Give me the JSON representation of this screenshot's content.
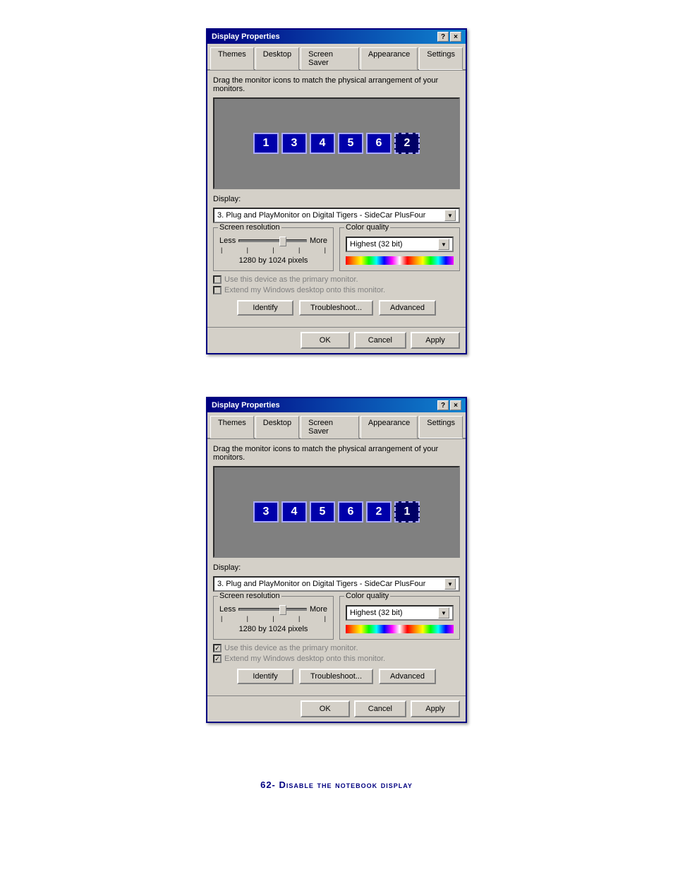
{
  "dialog1": {
    "title": "Display Properties",
    "title_buttons": [
      "?",
      "×"
    ],
    "tabs": [
      "Themes",
      "Desktop",
      "Screen Saver",
      "Appearance",
      "Settings"
    ],
    "active_tab": "Settings",
    "instruction": "Drag the monitor icons to match the physical arrangement of your monitors.",
    "monitors": [
      {
        "label": "1",
        "dashed": false
      },
      {
        "label": "3",
        "dashed": false
      },
      {
        "label": "4",
        "dashed": false
      },
      {
        "label": "5",
        "dashed": false
      },
      {
        "label": "6",
        "dashed": false
      },
      {
        "label": "2",
        "dashed": true
      }
    ],
    "display_label": "Display:",
    "display_value": "3. Plug and PlayMonitor on Digital Tigers - SideCar PlusFour",
    "screen_resolution": {
      "label": "Screen resolution",
      "less": "Less",
      "more": "More",
      "value": "1280 by 1024 pixels"
    },
    "color_quality": {
      "label": "Color quality",
      "value": "Highest (32 bit)"
    },
    "checkboxes": [
      {
        "label": "Use this device as the primary monitor.",
        "checked": false
      },
      {
        "label": "Extend my Windows desktop onto this monitor.",
        "checked": false
      }
    ],
    "buttons": [
      "Identify",
      "Troubleshoot...",
      "Advanced"
    ],
    "bottom_buttons": [
      "OK",
      "Cancel",
      "Apply"
    ]
  },
  "dialog2": {
    "title": "Display Properties",
    "title_buttons": [
      "?",
      "×"
    ],
    "tabs": [
      "Themes",
      "Desktop",
      "Screen Saver",
      "Appearance",
      "Settings"
    ],
    "active_tab": "Settings",
    "instruction": "Drag the monitor icons to match the physical arrangement of your monitors.",
    "monitors": [
      {
        "label": "3",
        "dashed": false
      },
      {
        "label": "4",
        "dashed": false
      },
      {
        "label": "5",
        "dashed": false
      },
      {
        "label": "6",
        "dashed": false
      },
      {
        "label": "2",
        "dashed": false
      },
      {
        "label": "1",
        "dashed": true
      }
    ],
    "display_label": "Display:",
    "display_value": "3. Plug and PlayMonitor on Digital Tigers - SideCar PlusFour",
    "screen_resolution": {
      "label": "Screen resolution",
      "less": "Less",
      "more": "More",
      "value": "1280 by 1024 pixels"
    },
    "color_quality": {
      "label": "Color quality",
      "value": "Highest (32 bit)"
    },
    "checkboxes": [
      {
        "label": "Use this device as the primary monitor.",
        "checked": true
      },
      {
        "label": "Extend my Windows desktop onto this monitor.",
        "checked": true
      }
    ],
    "buttons": [
      "Identify",
      "Troubleshoot...",
      "Advanced"
    ],
    "bottom_buttons": [
      "OK",
      "Cancel",
      "Apply"
    ]
  },
  "caption": "62- Disable the notebook display"
}
